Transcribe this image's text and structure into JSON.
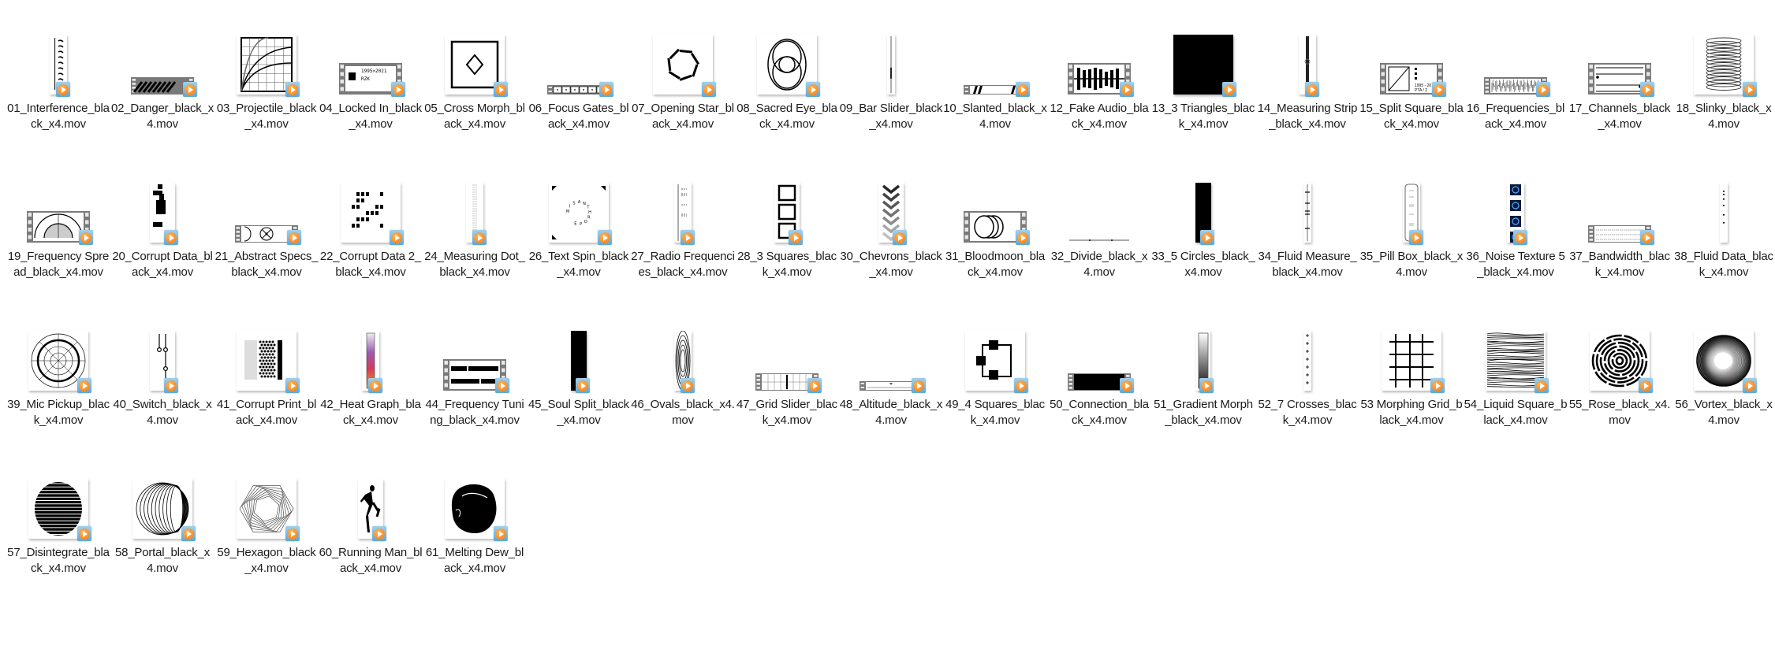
{
  "window": {
    "view": "Large icons",
    "item_type": "video file"
  },
  "colors": {
    "badge_blue": "#5aa8da",
    "badge_orange": "#f07a12",
    "film_gray": "#7a7a7a"
  },
  "files": [
    {
      "name": "01_Interference_black_x4.mov",
      "thumb": "tall-strip",
      "art": "squiggles"
    },
    {
      "name": "02_Danger_black_x4.mov",
      "thumb": "film-wide",
      "art": "stripes"
    },
    {
      "name": "03_Projectile_black_x4.mov",
      "thumb": "portrait",
      "art": "graph"
    },
    {
      "name": "04_Locked In_black_x4.mov",
      "thumb": "film",
      "art": "locked"
    },
    {
      "name": "05_Cross Morph_black_x4.mov",
      "thumb": "portrait",
      "art": "diamond"
    },
    {
      "name": "06_Focus Gates_black_x4.mov",
      "thumb": "film-thin",
      "art": "gates"
    },
    {
      "name": "07_Opening Star_black_x4.mov",
      "thumb": "portrait",
      "art": "star"
    },
    {
      "name": "08_Sacred Eye_black_x4.mov",
      "thumb": "portrait",
      "art": "eye"
    },
    {
      "name": "09_Bar Slider_black_x4.mov",
      "thumb": "hairline",
      "art": "bar"
    },
    {
      "name": "10_Slanted_black_x4.mov",
      "thumb": "film-thin",
      "art": "slanted"
    },
    {
      "name": "12_Fake Audio_black_x4.mov",
      "thumb": "film",
      "art": "audio"
    },
    {
      "name": "13_3 Triangles_black_x4.mov",
      "thumb": "black-portrait",
      "art": "solid"
    },
    {
      "name": "14_Measuring Strip_black_x4.mov",
      "thumb": "tall-strip",
      "art": "ruler"
    },
    {
      "name": "15_Split Square_black_x4.mov",
      "thumb": "film",
      "art": "split"
    },
    {
      "name": "16_Frequencies_black_x4.mov",
      "thumb": "film-wide",
      "art": "noise"
    },
    {
      "name": "17_Channels_black_x4.mov",
      "thumb": "film",
      "art": "channels"
    },
    {
      "name": "18_Slinky_black_x4.mov",
      "thumb": "portrait",
      "art": "slinky"
    },
    {
      "name": "19_Frequency Spread_black_x4.mov",
      "thumb": "film",
      "art": "spread"
    },
    {
      "name": "20_Corrupt Data_black_x4.mov",
      "thumb": "narrow",
      "art": "blocks"
    },
    {
      "name": "21_Abstract Specs_black_x4.mov",
      "thumb": "film-wide",
      "art": "specs"
    },
    {
      "name": "22_Corrupt Data 2_black_x4.mov",
      "thumb": "portrait",
      "art": "dots"
    },
    {
      "name": "24_Measuring Dot_black_x4.mov",
      "thumb": "tall-strip",
      "art": "ticks"
    },
    {
      "name": "26_Text Spin_black_x4.mov",
      "thumb": "portrait",
      "art": "textspin",
      "text": "MISANTHROPE"
    },
    {
      "name": "27_Radio Frequencies_black_x4.mov",
      "thumb": "tall-strip",
      "art": "radio"
    },
    {
      "name": "28_3 Squares_black_x4.mov",
      "thumb": "narrow",
      "art": "squares"
    },
    {
      "name": "30_Chevrons_black_x4.mov",
      "thumb": "narrow",
      "art": "chevrons"
    },
    {
      "name": "31_Bloodmoon_black_x4.mov",
      "thumb": "film",
      "art": "circles3"
    },
    {
      "name": "32_Divide_black_x4.mov",
      "thumb": "line",
      "art": "divide"
    },
    {
      "name": "33_5 Circles_black_x4.mov",
      "thumb": "black-narrow",
      "art": "solid"
    },
    {
      "name": "34_Fluid Measure_black_x4.mov",
      "thumb": "hairline",
      "art": "fluid"
    },
    {
      "name": "35_Pill Box_black_x4.mov",
      "thumb": "tall-strip",
      "art": "pill"
    },
    {
      "name": "36_Noise Texture 5_black_x4.mov",
      "thumb": "tall-strip",
      "art": "bluenoise"
    },
    {
      "name": "37_Bandwidth_black_x4.mov",
      "thumb": "film-wide",
      "art": "bandwidth"
    },
    {
      "name": "38_Fluid Data_black_x4.mov",
      "thumb": "hairline",
      "art": "fluiddata"
    },
    {
      "name": "39_Mic Pickup_black_x4.mov",
      "thumb": "square",
      "art": "polar"
    },
    {
      "name": "40_Switch_black_x4.mov",
      "thumb": "narrow",
      "art": "switch"
    },
    {
      "name": "41_Corrupt Print_black_x4.mov",
      "thumb": "square",
      "art": "halftone"
    },
    {
      "name": "42_Heat Graph_black_x4.mov",
      "thumb": "tall-strip",
      "art": "heat"
    },
    {
      "name": "44_Frequency Tuning_black_x4.mov",
      "thumb": "film",
      "art": "tuning"
    },
    {
      "name": "45_Soul Split_black_x4.mov",
      "thumb": "black-narrow",
      "art": "solid"
    },
    {
      "name": "46_Ovals_black_x4.mov",
      "thumb": "tall-strip",
      "art": "ovals"
    },
    {
      "name": "47_Grid Slider_black_x4.mov",
      "thumb": "film-wide",
      "art": "gridslider"
    },
    {
      "name": "48_Altitude_black_x4.mov",
      "thumb": "film-thin",
      "art": "altitude"
    },
    {
      "name": "49_4 Squares_black_x4.mov",
      "thumb": "square",
      "art": "foursquares"
    },
    {
      "name": "50_Connection_black_x4.mov",
      "thumb": "film-wide",
      "art": "blackfill"
    },
    {
      "name": "51_Gradient Morph_black_x4.mov",
      "thumb": "narrow-thin",
      "art": "gradient"
    },
    {
      "name": "52_7 Crosses_black_x4.mov",
      "thumb": "hairline",
      "art": "crosses"
    },
    {
      "name": "53 Morphing Grid_black_x4.mov",
      "thumb": "portrait",
      "art": "grid"
    },
    {
      "name": "54_Liquid Square_black_x4.mov",
      "thumb": "square",
      "art": "liquid"
    },
    {
      "name": "55_Rose_black_x4.mov",
      "thumb": "square",
      "art": "rose"
    },
    {
      "name": "56_Vortex_black_x4.mov",
      "thumb": "square",
      "art": "vortex"
    },
    {
      "name": "57_Disintegrate_black_x4.mov",
      "thumb": "square",
      "art": "disintegrate"
    },
    {
      "name": "58_Portal_black_x4.mov",
      "thumb": "square",
      "art": "portal"
    },
    {
      "name": "59_Hexagon_black_x4.mov",
      "thumb": "square",
      "art": "hexagon"
    },
    {
      "name": "60_Running Man_black_x4.mov",
      "thumb": "narrow",
      "art": "runner"
    },
    {
      "name": "61_Melting Dew_black_x4.mov",
      "thumb": "square",
      "art": "blob"
    }
  ]
}
